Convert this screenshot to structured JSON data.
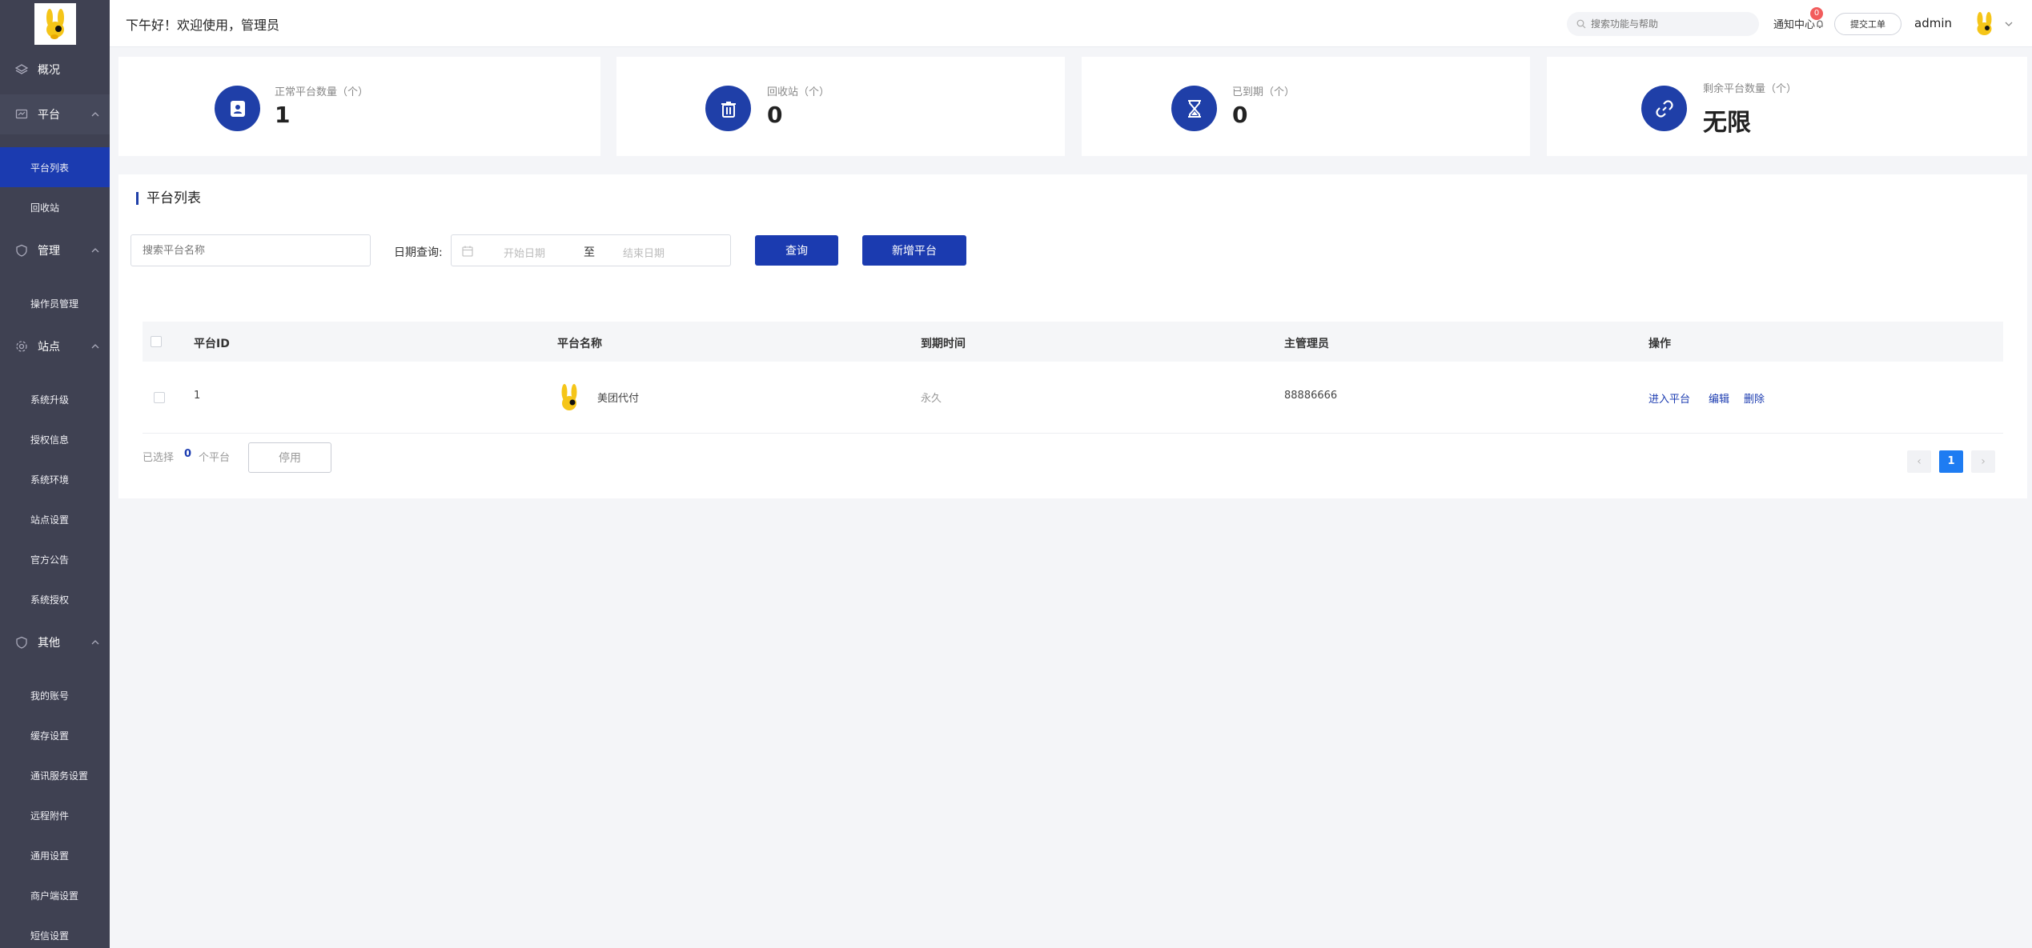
{
  "header": {
    "greeting": "下午好！欢迎使用，管理员",
    "search_placeholder": "搜索功能与帮助",
    "notify_label": "通知中心",
    "notify_count": "0",
    "submit_ticket": "提交工单",
    "user_name": "admin"
  },
  "sidebar": {
    "overview": "概况",
    "platform": "平台",
    "platform_list": "平台列表",
    "recycle": "回收站",
    "manage": "管理",
    "operators": "操作员管理",
    "site": "站点",
    "site_items": [
      "系统升级",
      "授权信息",
      "系统环境",
      "站点设置",
      "官方公告",
      "系统授权"
    ],
    "other": "其他",
    "other_items": [
      "我的账号",
      "缓存设置",
      "通讯服务设置",
      "远程附件",
      "通用设置",
      "商户端设置",
      "短信设置"
    ]
  },
  "stats": [
    {
      "label": "正常平台数量（个）",
      "value": "1"
    },
    {
      "label": "回收站（个）",
      "value": "0"
    },
    {
      "label": "已到期（个）",
      "value": "0"
    },
    {
      "label": "剩余平台数量（个）",
      "value": "无限"
    }
  ],
  "panel": {
    "title": "平台列表",
    "name_placeholder": "搜索平台名称",
    "date_label": "日期查询:",
    "start_placeholder": "开始日期",
    "to": "至",
    "end_placeholder": "结束日期",
    "query_btn": "查询",
    "add_btn": "新增平台"
  },
  "table": {
    "headers": [
      "平台ID",
      "平台名称",
      "到期时间",
      "主管理员",
      "操作"
    ],
    "rows": [
      {
        "id": "1",
        "name": "美团代付",
        "expire": "永久",
        "admin": "88886666",
        "actions": [
          "进入平台",
          "编辑",
          "删除"
        ]
      }
    ],
    "footer_prefix": "已选择",
    "selected_count": "0",
    "footer_suffix": "个平台",
    "disable_btn": "停用",
    "pagination": {
      "prev": "‹",
      "current": "1",
      "next": "›"
    }
  },
  "colors": {
    "sidebar_bg": "#3f4152",
    "accent": "#1b3bb0",
    "page_bg": "#f4f5f8",
    "badge": "#f25c5c"
  },
  "icons": [
    "layers-icon",
    "chart-board-icon",
    "shield-icon",
    "gear-icon",
    "search-icon",
    "bell-icon",
    "contact-card-icon",
    "trash-icon",
    "hourglass-icon",
    "link-icon",
    "calendar-icon",
    "chevron-up-icon",
    "chevron-down-icon",
    "mascot-logo"
  ]
}
